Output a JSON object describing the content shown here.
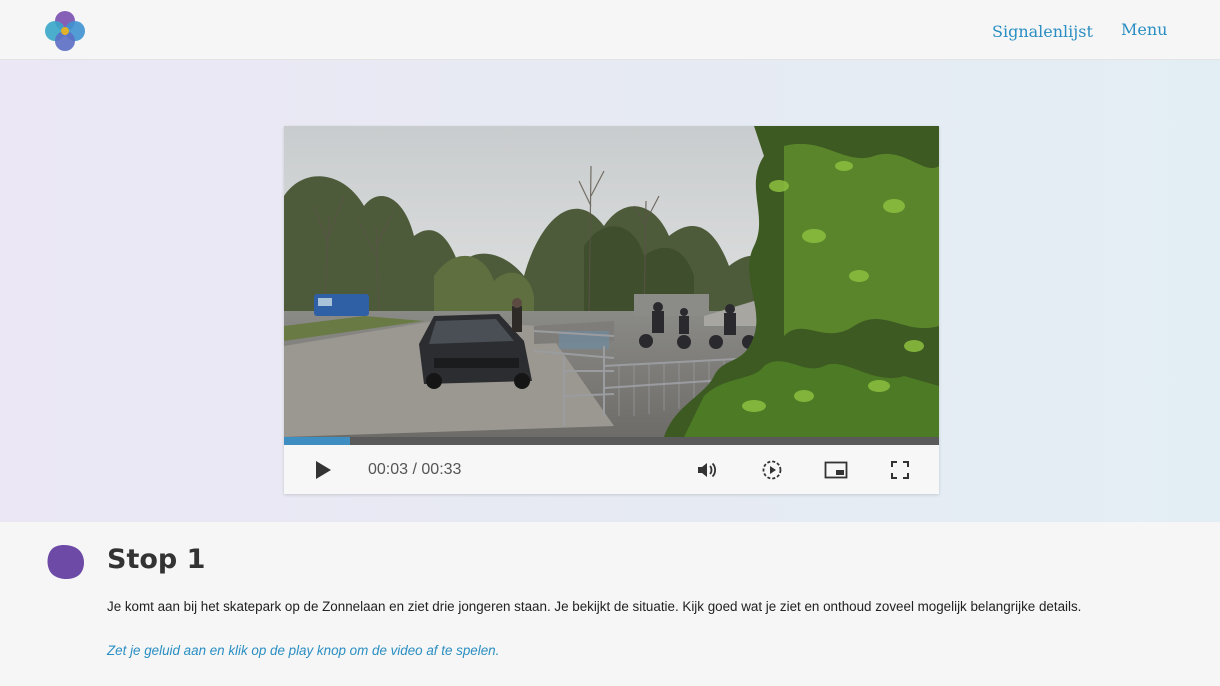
{
  "header": {
    "nav": {
      "signalenlijst_label": "Signalenlijst",
      "menu_label": "Menu"
    }
  },
  "video": {
    "current_time": "00:03",
    "time_separator": "/",
    "duration": "00:33",
    "progress": 0.1,
    "controls": {
      "play_icon": "play-icon",
      "volume_icon": "volume-icon",
      "speed_icon": "playback-speed-icon",
      "pip_icon": "picture-in-picture-icon",
      "fullscreen_icon": "fullscreen-icon"
    }
  },
  "content": {
    "stop_title": "Stop 1",
    "description": "Je komt aan bij het skatepark op de Zonnelaan en ziet drie jongeren staan. Je bekijkt de situatie. Kijk goed wat je ziet en onthoud zoveel mogelijk belangrijke details.",
    "instruction": "Zet je geluid aan en klik op de play knop om de video af te spelen."
  },
  "colors": {
    "accent_blue": "#2a8ec2",
    "progress_blue": "#3e8ec2",
    "blob_purple": "#6d4aa6"
  }
}
